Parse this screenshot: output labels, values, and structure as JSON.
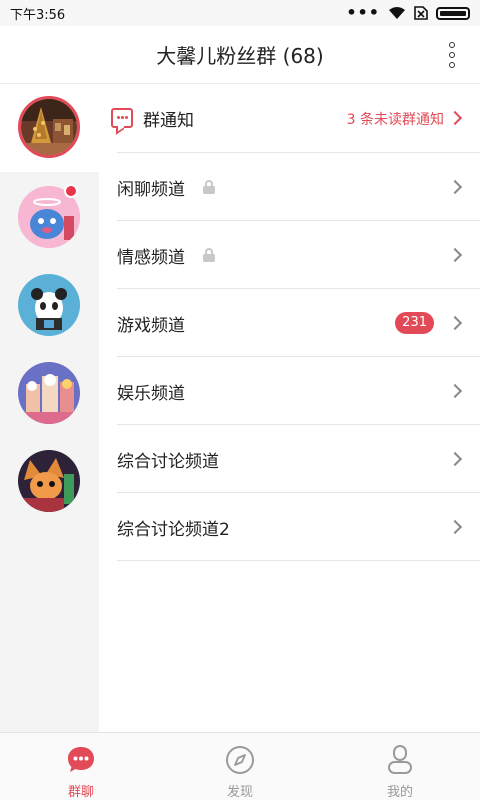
{
  "status_bar": {
    "time": "下午3:56",
    "dots": "•••"
  },
  "header": {
    "title": "大馨儿粉丝群 (68)"
  },
  "notice": {
    "label": "群通知",
    "unread": "3 条未读群通知"
  },
  "channels": [
    {
      "label": "闲聊频道",
      "locked": true
    },
    {
      "label": "情感频道",
      "locked": true
    },
    {
      "label": "游戏频道",
      "badge": "231"
    },
    {
      "label": "娱乐频道"
    },
    {
      "label": "综合讨论频道"
    },
    {
      "label": "综合讨论频道2"
    }
  ],
  "tabs": [
    {
      "label": "群聊",
      "icon": "chat-bubble-icon",
      "active": true
    },
    {
      "label": "发现",
      "icon": "compass-icon"
    },
    {
      "label": "我的",
      "icon": "person-icon"
    }
  ],
  "colors": {
    "accent": "#e24a57",
    "sidebar_bg": "#f4f4f4"
  }
}
